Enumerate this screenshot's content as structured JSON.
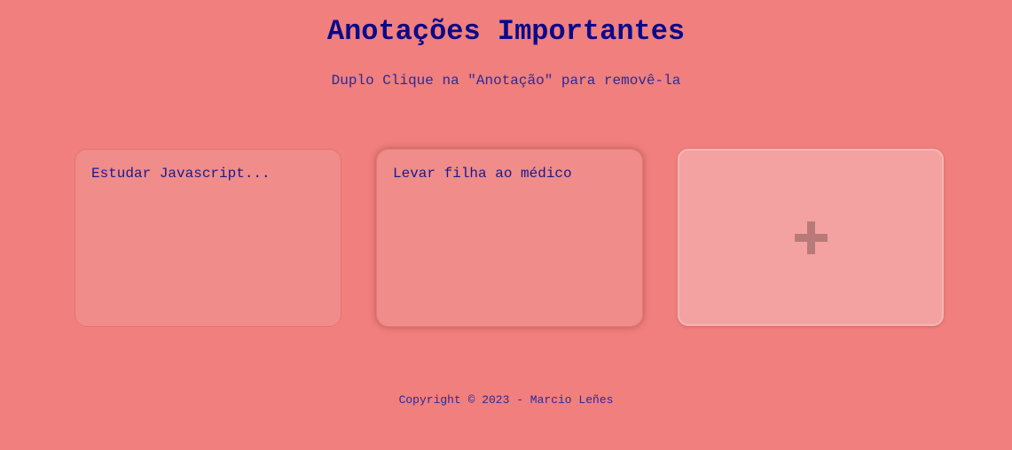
{
  "header": {
    "title": "Anotações Importantes",
    "subtitle": "Duplo Clique na \"Anotação\" para removê-la"
  },
  "notes": [
    {
      "text": "Estudar Javascript..."
    },
    {
      "text": "Levar filha ao médico"
    }
  ],
  "add_button": {
    "icon": "plus-icon"
  },
  "footer": {
    "copyright": "Copyright © 2023 - Marcio Leñes"
  },
  "colors": {
    "background": "#f07f7d",
    "note": "#f08c8a",
    "add_button": "#f3a2a1",
    "title": "#0a0a8a"
  }
}
